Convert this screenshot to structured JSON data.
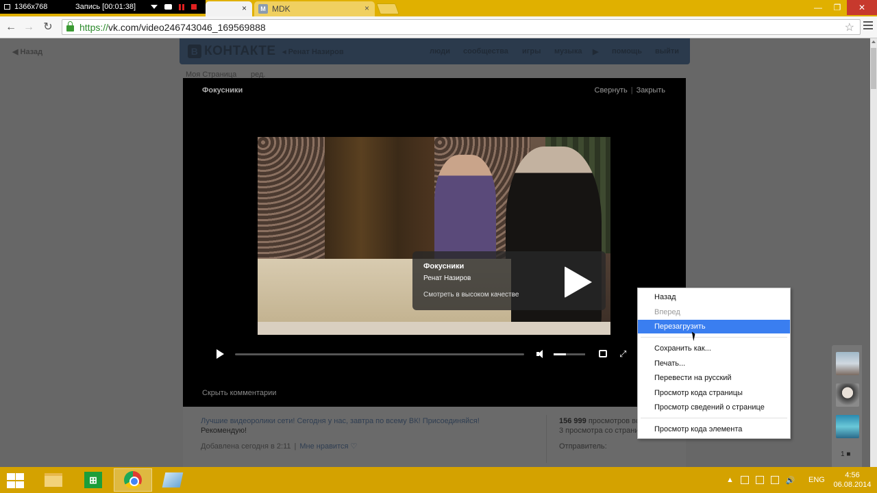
{
  "recorder": {
    "resolution": "1366x768",
    "recording": "Запись [00:01:38]"
  },
  "tabs": [
    {
      "label": "",
      "close": "×"
    },
    {
      "label": "MDK",
      "close": "×",
      "favicon": "М"
    }
  ],
  "address": {
    "scheme": "https://",
    "rest": "vk.com/video246743046_169569888"
  },
  "page": {
    "back": "Назад",
    "logo": "КОНТАКТЕ",
    "logo_letter": "В",
    "user": "Ренат Назиров",
    "menu": [
      "люди",
      "сообщества",
      "игры",
      "музыка",
      "помощь",
      "выйти"
    ],
    "my_page": "Моя Страница",
    "edit": "ред."
  },
  "video": {
    "title": "Фокусники",
    "collapse": "Свернуть",
    "close": "Закрыть",
    "overlay_title": "Фокусники",
    "overlay_author": "Ренат Назиров",
    "overlay_hq": "Смотреть в высоком качестве",
    "hide_comments": "Скрыть комментарии",
    "progress": 0,
    "volume": 0.4
  },
  "info": {
    "description": "Лучшие видеоролики сети! Сегодня у нас, завтра по всему ВК! Присоединяйся!",
    "recommend": "Рекомендую!",
    "added": "Добавлена сегодня в 2:11",
    "like": "Мне нравится ♡",
    "views_count": "156 999",
    "views_label": "просмотров вс",
    "page_views": "3 просмотра со страницы",
    "sender": "Отправитель:"
  },
  "friends": {
    "count": "1"
  },
  "context_menu": {
    "items": [
      {
        "label": "Назад",
        "state": "normal"
      },
      {
        "label": "Вперед",
        "state": "disabled"
      },
      {
        "label": "Перезагрузить",
        "state": "active"
      },
      {
        "label": "Сохранить как...",
        "state": "normal"
      },
      {
        "label": "Печать...",
        "state": "normal"
      },
      {
        "label": "Перевести на русский",
        "state": "normal"
      },
      {
        "label": "Просмотр кода страницы",
        "state": "normal"
      },
      {
        "label": "Просмотр  сведений о странице",
        "state": "normal"
      },
      {
        "label": "Просмотр кода элемента",
        "state": "normal"
      }
    ]
  },
  "taskbar": {
    "lang": "ENG",
    "time": "4:56",
    "date": "06.08.2014"
  },
  "colors": {
    "accent": "#3a7ef0",
    "taskbar": "#d4a200",
    "vk_header": "#2b3a4c"
  },
  "icons": [
    "window-icon",
    "camera-icon",
    "pause-icon",
    "stop-icon",
    "lock-icon",
    "star-icon",
    "menu-icon",
    "play-icon",
    "volume-icon",
    "loop-icon",
    "fullscreen-icon",
    "start-icon",
    "folder-icon",
    "store-icon",
    "chrome-icon"
  ]
}
